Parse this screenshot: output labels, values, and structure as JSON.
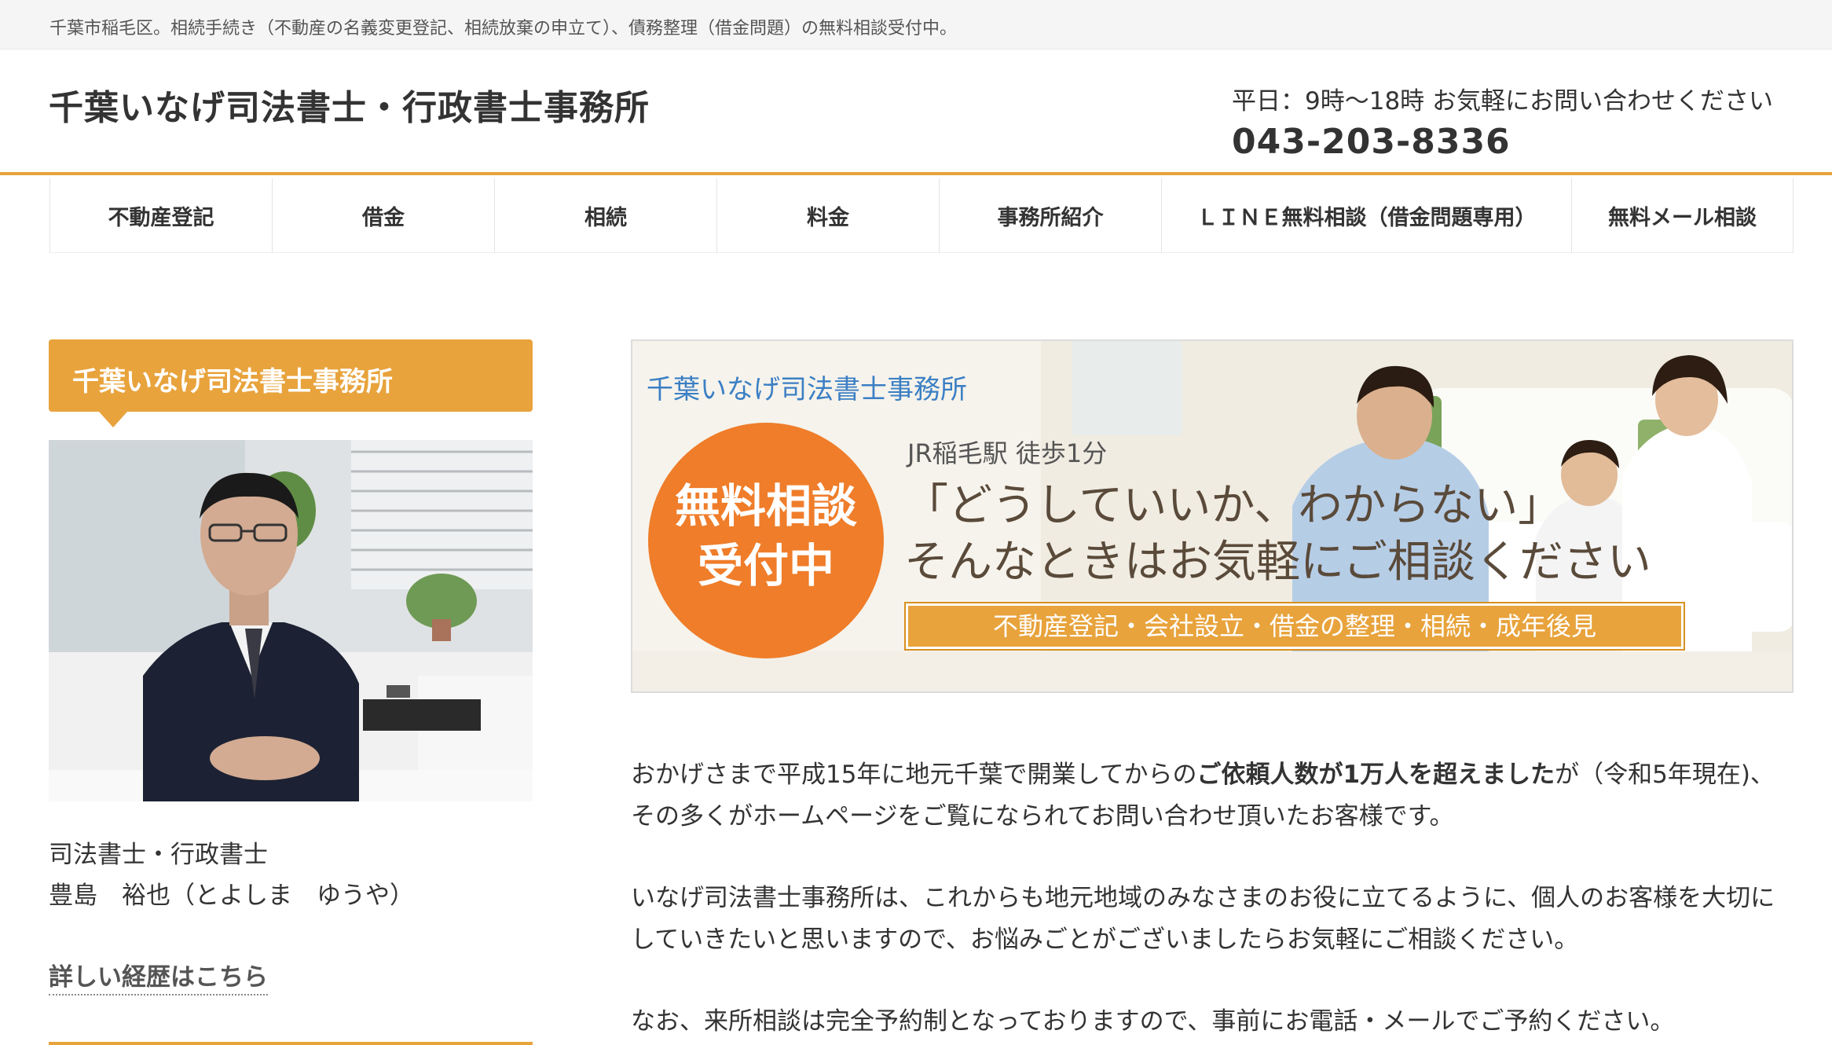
{
  "topbar": {
    "text": "千葉市稲毛区。相続手続き（不動産の名義変更登記、相続放棄の申立て）、債務整理（借金問題）の無料相談受付中。"
  },
  "header": {
    "site_title": "千葉いなげ司法書士・行政書士事務所",
    "hours": "平日：9時〜18時 お気軽にお問い合わせください",
    "phone": "043-203-8336"
  },
  "nav": {
    "items": [
      {
        "label": "不動産登記"
      },
      {
        "label": "借金"
      },
      {
        "label": "相続"
      },
      {
        "label": "料金"
      },
      {
        "label": "事務所紹介"
      },
      {
        "label": "ＬＩＮＥ無料相談（借金問題専用）"
      },
      {
        "label": "無料メール相談"
      }
    ]
  },
  "sidebar": {
    "title": "千葉いなげ司法書士事務所",
    "role": "司法書士・行政書士",
    "name": "豊島　裕也（とよしま　ゆうや）",
    "link": "詳しい経歴はこちら"
  },
  "banner": {
    "title": "千葉いなげ司法書士事務所",
    "circle_line1": "無料相談",
    "circle_line2": "受付中",
    "station": "JR稲毛駅 徒歩1分",
    "headline1": "「どうしていいか、わからない」",
    "headline2": "そんなときはお気軽にご相談ください",
    "services": "不動産登記・会社設立・借金の整理・相続・成年後見"
  },
  "content": {
    "p1_a": "おかげさまで平成15年に地元千葉で開業してからの",
    "p1_bold": "ご依頼人数が1万人を超えました",
    "p1_b": "が（令和5年現在)、その多くがホームページをご覧になられてお問い合わせ頂いたお客様です。",
    "p2": "いなげ司法書士事務所は、これからも地元地域のみなさまのお役に立てるように、個人のお客様を大切にしていきたいと思いますので、お悩みごとがございましたらお気軽にご相談ください。",
    "p3": "なお、来所相談は完全予約制となっておりますので、事前にお電話・メールでご予約ください。"
  },
  "colors": {
    "accent": "#e8a33c",
    "circle": "#ef7d2a",
    "banner_title": "#3b7fc4"
  }
}
